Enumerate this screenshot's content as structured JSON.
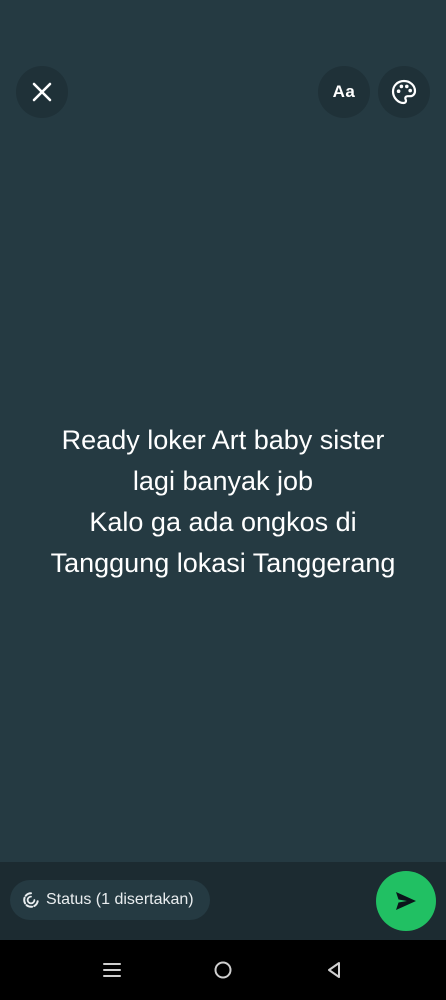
{
  "toolbar": {
    "close_icon": "close-icon",
    "font_label": "Aa",
    "palette_icon": "palette-icon"
  },
  "status": {
    "lines": [
      "Ready loker Art baby sister",
      "lagi banyak job",
      "Kalo ga ada ongkos di",
      "Tanggung lokasi Tanggerang"
    ]
  },
  "footer": {
    "audience_label": "Status (1 disertakan)",
    "audience_icon": "status-ring-icon",
    "send_icon": "send-icon"
  },
  "navigation": {
    "menu_icon": "recent-apps-icon",
    "home_icon": "home-icon",
    "back_icon": "back-icon"
  },
  "colors": {
    "background": "#253a42",
    "send_button": "#21c063",
    "text": "#ffffff"
  }
}
